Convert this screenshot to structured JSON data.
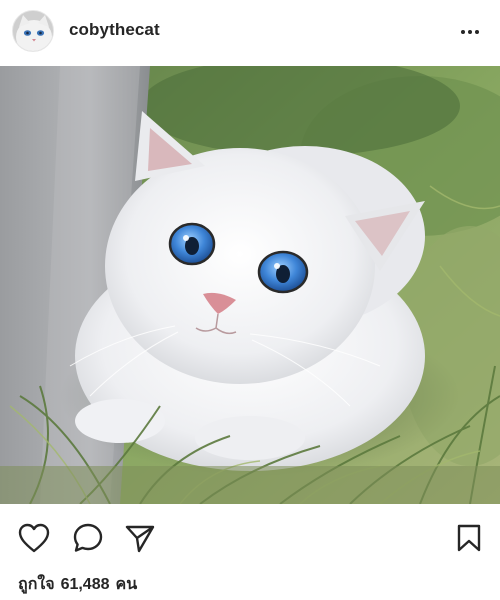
{
  "post": {
    "username": "cobythecat",
    "likes_prefix": "ถูกใจ",
    "likes_count": "61,488",
    "likes_suffix": "คน"
  },
  "icons": {
    "avatar": "cat-avatar",
    "more": "more-options-icon",
    "like": "heart-icon",
    "comment": "comment-icon",
    "share": "share-icon",
    "save": "bookmark-icon"
  },
  "colors": {
    "text": "#262626",
    "background": "#ffffff"
  }
}
